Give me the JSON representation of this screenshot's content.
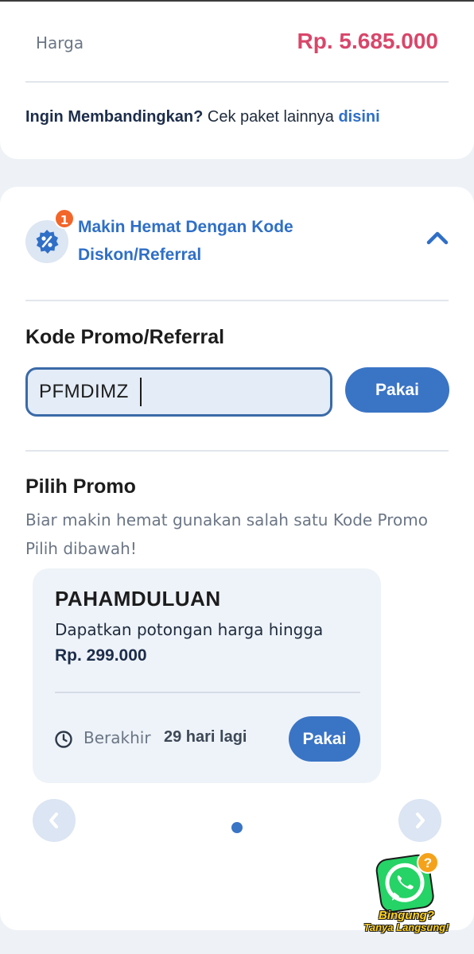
{
  "price_section": {
    "label": "Harga",
    "value": "Rp. 5.685.000",
    "compare_bold": "Ingin Membandingkan?",
    "compare_text": " Cek paket lainnya ",
    "compare_link": "disini"
  },
  "promo_section": {
    "badge_count": "1",
    "title": "Makin Hemat Dengan Kode Diskon/Referral",
    "code_label": "Kode Promo/Referral",
    "code_value": "PFMDIMZ",
    "apply_label": "Pakai",
    "choose_title": "Pilih Promo",
    "choose_subtext": "Biar makin hemat gunakan salah satu Kode Promo Pilih dibawah!"
  },
  "promo_cards": [
    {
      "code": "PAHAMDULUAN",
      "description": "Dapatkan potongan harga hingga",
      "amount": "Rp. 299.000",
      "expire_label": "Berakhir",
      "expire_value": "29 hari lagi",
      "button_label": "Pakai"
    }
  ],
  "carousel": {
    "active_index": 1,
    "total": 1
  },
  "help": {
    "line1": "Bingung?",
    "line2": "Tanya Langsung!",
    "badge": "?"
  },
  "colors": {
    "accent": "#3a74c5",
    "price": "#d9466a",
    "badge": "#f2662a",
    "whatsapp": "#25d366"
  },
  "icons": [
    "discount-icon",
    "chevron-up-icon",
    "clock-icon",
    "chevron-left-icon",
    "chevron-right-icon",
    "whatsapp-icon"
  ]
}
